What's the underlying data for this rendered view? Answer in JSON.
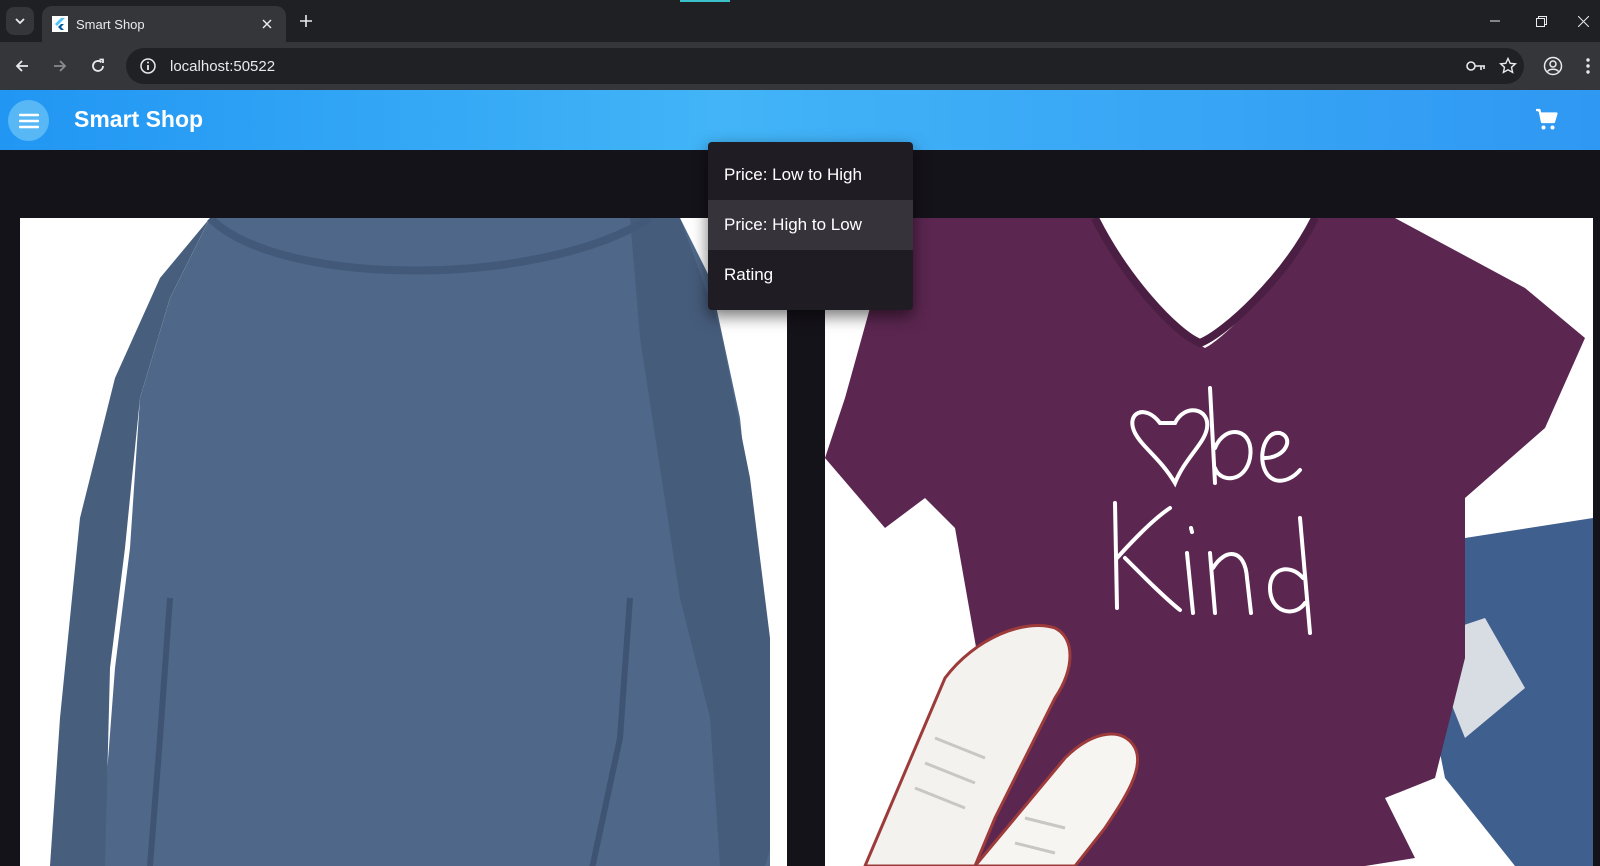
{
  "browser": {
    "tab_title": "Smart Shop",
    "url": "localhost:50522"
  },
  "appbar": {
    "title": "Smart Shop"
  },
  "sort_menu": {
    "options": [
      {
        "label": "Price: Low to High"
      },
      {
        "label": "Price: High to Low"
      },
      {
        "label": "Rating"
      }
    ],
    "highlighted_index": 1
  },
  "products": [
    {
      "image": "blue long-sleeve shirt",
      "color": "#4f6889"
    },
    {
      "image": "purple be kind t-shirt",
      "color": "#5b2650",
      "print_text": "be Kind"
    }
  ],
  "colors": {
    "appbar_start": "#2196f3",
    "appbar_end": "#42b4f7",
    "background": "#15131a",
    "menu_bg": "#1f1c24"
  }
}
